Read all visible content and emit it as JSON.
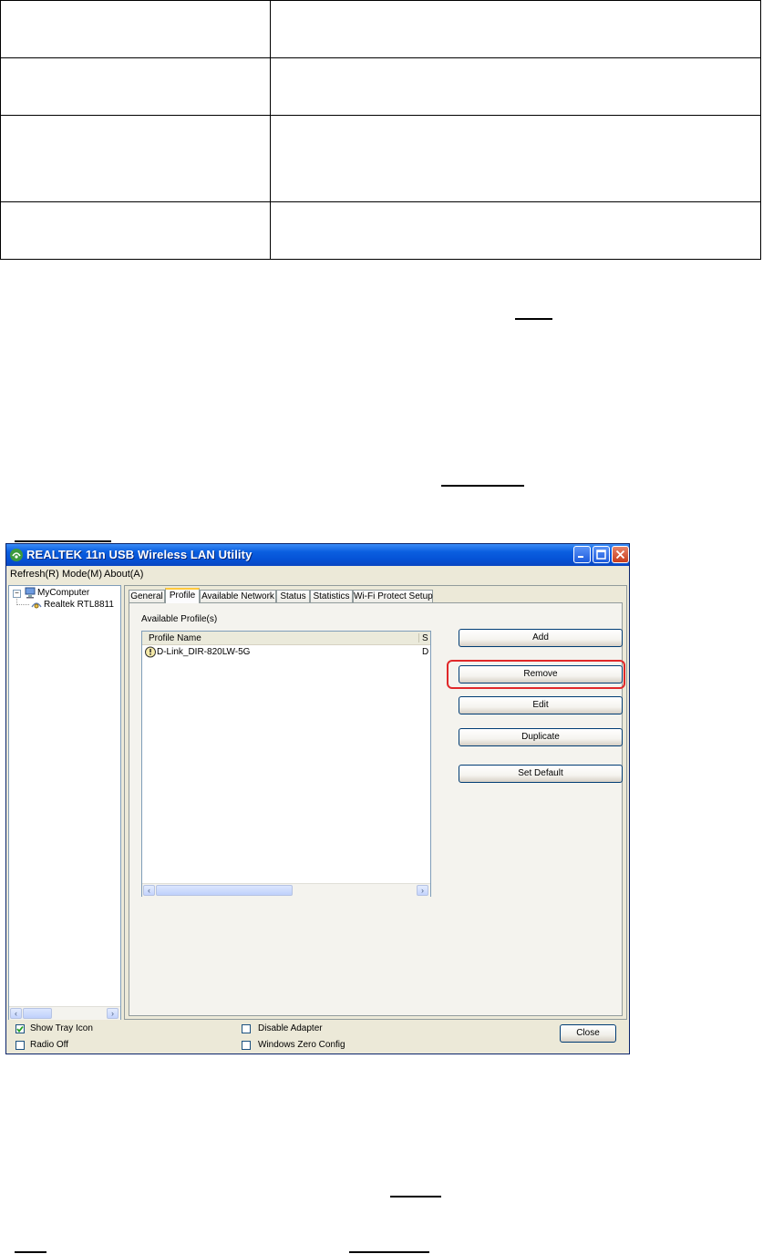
{
  "window": {
    "title": "REALTEK 11n USB Wireless LAN Utility"
  },
  "menu": {
    "items": [
      {
        "label": "Refresh(R)"
      },
      {
        "label": "Mode(M)"
      },
      {
        "label": "About(A)"
      }
    ]
  },
  "tree": {
    "root": "MyComputer",
    "child": "Realtek RTL8811"
  },
  "tabs": [
    {
      "label": "General"
    },
    {
      "label": "Profile",
      "active": true
    },
    {
      "label": "Available Network"
    },
    {
      "label": "Status"
    },
    {
      "label": "Statistics"
    },
    {
      "label": "Wi-Fi Protect Setup"
    }
  ],
  "profile": {
    "section_label": "Available Profile(s)",
    "columns": [
      "Profile Name",
      "S"
    ],
    "rows": [
      {
        "name": "D-Link_DIR-820LW-5G",
        "col2": "D"
      }
    ],
    "buttons": {
      "add": "Add",
      "remove": "Remove",
      "edit": "Edit",
      "duplicate": "Duplicate",
      "set_default": "Set Default"
    }
  },
  "bottom": {
    "show_tray_icon": {
      "label": "Show Tray Icon",
      "checked": true
    },
    "radio_off": {
      "label": "Radio Off",
      "checked": false
    },
    "disable_adapter": {
      "label": "Disable Adapter",
      "checked": false
    },
    "windows_zero_config": {
      "label": "Windows Zero Config",
      "checked": false
    },
    "close": "Close"
  },
  "colors": {
    "titlebar": "#0b5fe0",
    "highlight": "#e0282a",
    "window_bg": "#ece9d8"
  }
}
